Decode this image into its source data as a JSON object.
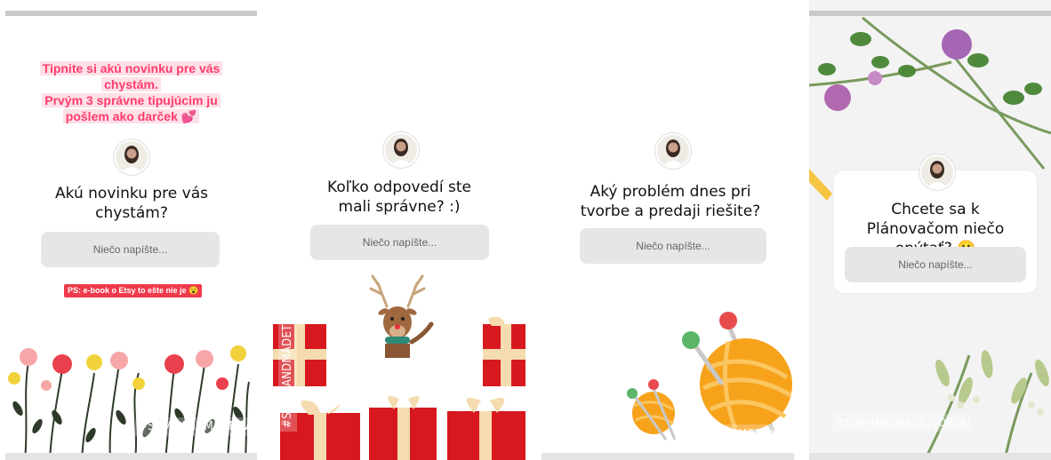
{
  "stories": [
    {
      "promo_lines": [
        "Tipnite si akú novinku pre vás",
        "chystám.",
        "Prvým 3 správne tipujúcim ju",
        "pošlem ako darček 💕"
      ],
      "question": "Akú novinku pre vás chystám?",
      "placeholder": "Niečo napíšte...",
      "ps": "PS: e-book o Etsy to ešte nie je 😮",
      "hashtag": "#SOMHANDMADETVORCA"
    },
    {
      "question": "Koľko odpovedí ste mali správne? :)",
      "placeholder": "Niečo napíšte...",
      "hashtag": "#SOMHANDMADETVORCA"
    },
    {
      "question": "Aký problém dnes pri tvorbe a predaji riešite?",
      "placeholder": "Niečo napíšte...",
      "hashtag": "#SOMHANDMADETVORCA"
    },
    {
      "question": "Chcete sa k Plánovačom niečo opýtať? 🙂",
      "placeholder": "Niečo napíšte...",
      "hashtag": "#SOMHANDMADETVORCA"
    }
  ],
  "colors": {
    "promo_text": "#ff3c6e",
    "ps_label": "#f03a4b",
    "input_bg": "#e6e6e6",
    "gift_red": "#d7191f",
    "yarn_orange": "#f7a21b"
  }
}
